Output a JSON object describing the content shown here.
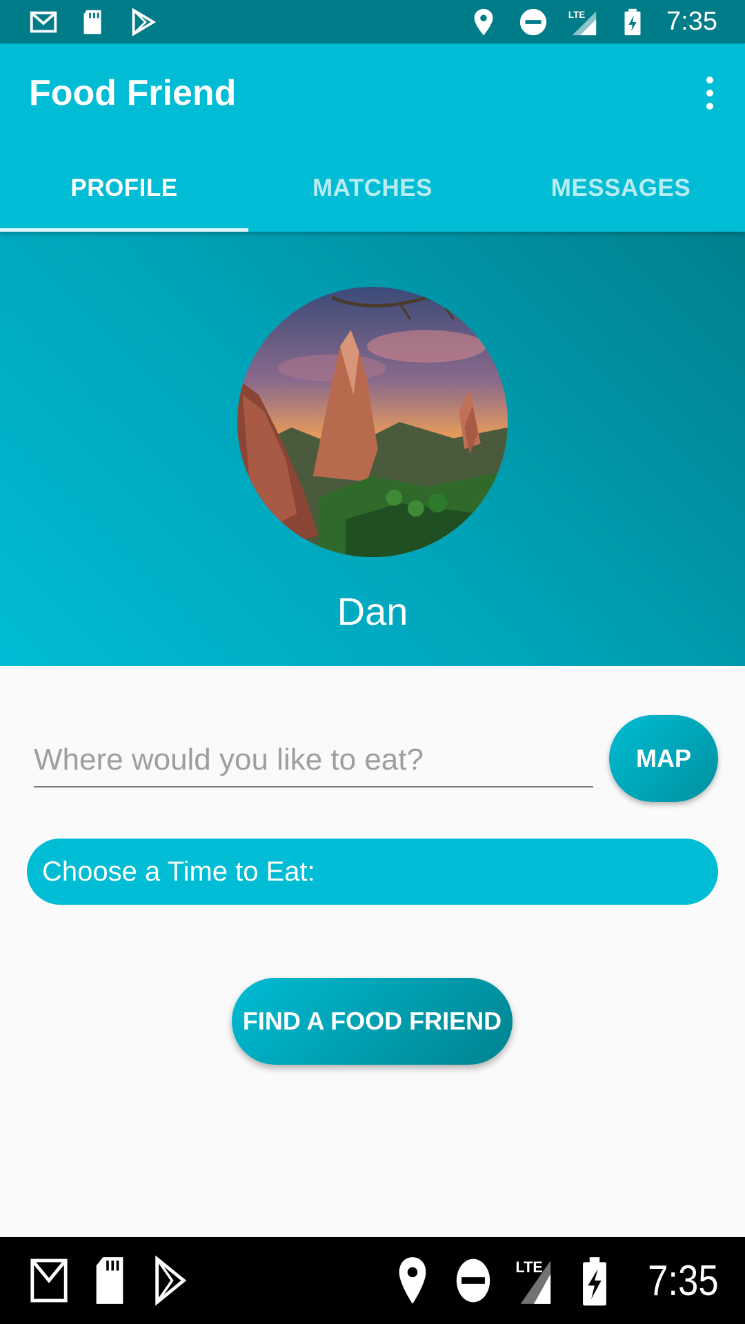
{
  "status_bar": {
    "time": "7:35",
    "left_icons": [
      "gmail-icon",
      "sd-card-icon",
      "play-store-icon"
    ],
    "right_icons": [
      "location-icon",
      "do-not-disturb-icon",
      "lte-signal-icon",
      "battery-charging-icon"
    ]
  },
  "app_bar": {
    "title": "Food Friend",
    "overflow_icon": "more-vert-icon"
  },
  "tabs": [
    {
      "label": "PROFILE",
      "active": true
    },
    {
      "label": "MATCHES",
      "active": false
    },
    {
      "label": "MESSAGES",
      "active": false
    }
  ],
  "profile": {
    "name": "Dan",
    "avatar": "landscape-rock-formation-photo"
  },
  "form": {
    "location_placeholder": "Where would you like to eat?",
    "location_value": "",
    "map_label": "MAP",
    "time_label": "Choose a Time to Eat:",
    "find_label": "FIND A FOOD FRIEND"
  },
  "nav_bar": {
    "time": "7:35"
  },
  "colors": {
    "primary": "#00bcd4",
    "primary_dark": "#007c89",
    "background": "#fafafa"
  }
}
